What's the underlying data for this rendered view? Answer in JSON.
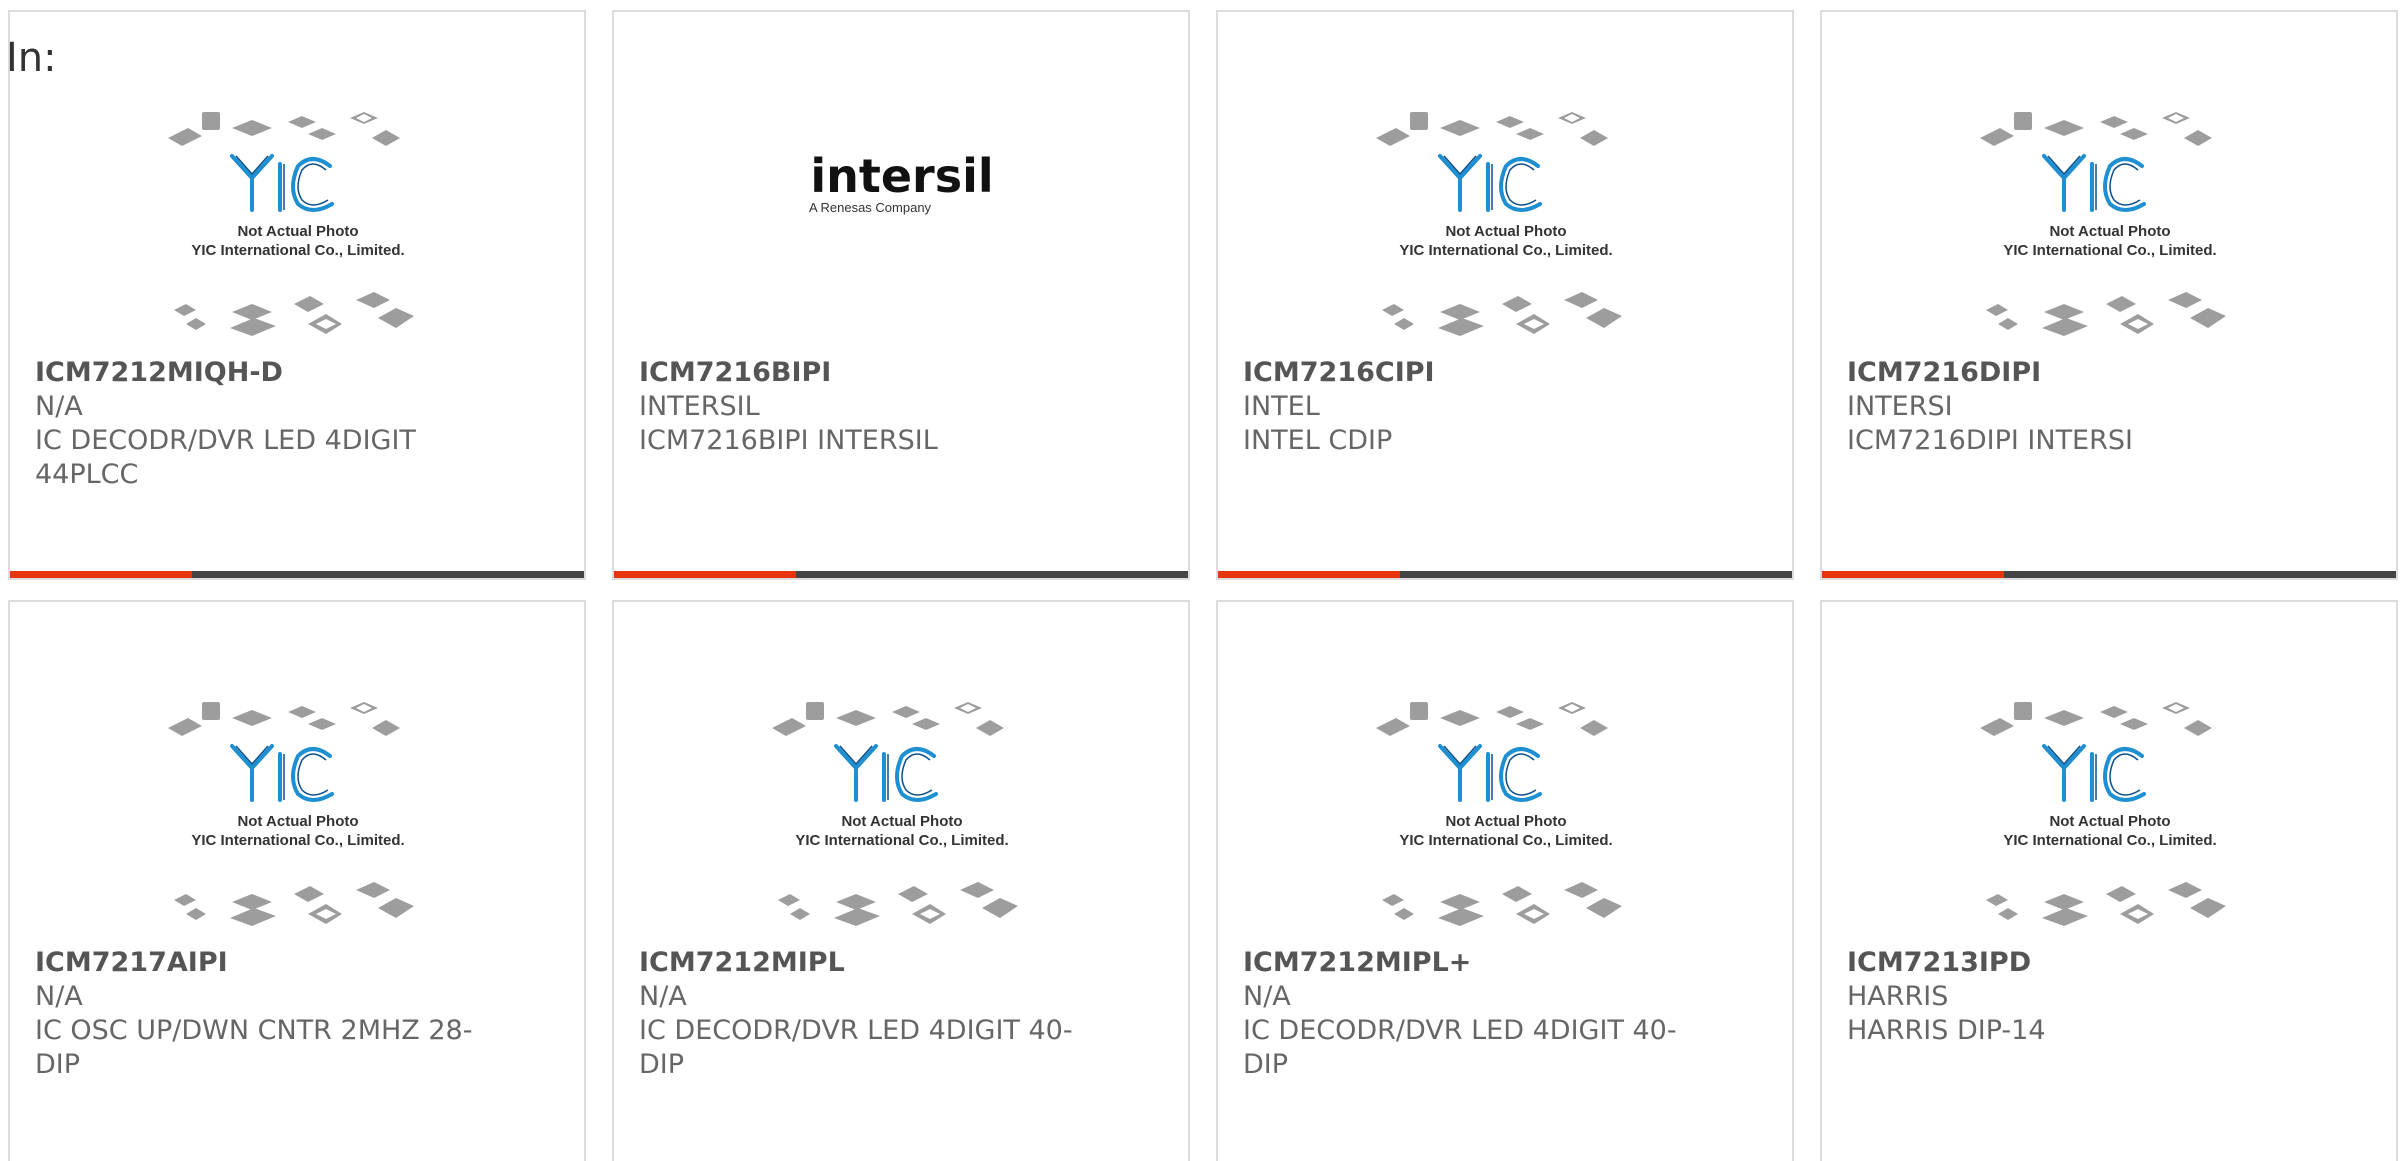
{
  "header": {
    "in_label": "In:"
  },
  "placeholder_image": {
    "caption_line1": "Not Actual Photo",
    "caption_line2": "YIC International Co., Limited.",
    "logo_text": "YIC"
  },
  "intersil_logo": {
    "name": "intersil",
    "tagline": "A Renesas Company"
  },
  "colors": {
    "accent": "#e8340c",
    "bar": "#444444",
    "yic_blue": "#1e8fd0"
  },
  "products": [
    {
      "part": "ICM7212MIQH-D",
      "manufacturer": "N/A",
      "desc_line1": "IC DECODR/DVR LED 4DIGIT",
      "desc_line2": "44PLCC",
      "image": "placeholder"
    },
    {
      "part": "ICM7216BIPI",
      "manufacturer": "INTERSIL",
      "desc_line1": "ICM7216BIPI INTERSIL",
      "desc_line2": "",
      "image": "intersil"
    },
    {
      "part": "ICM7216CIPI",
      "manufacturer": "INTEL",
      "desc_line1": "INTEL CDIP",
      "desc_line2": "",
      "image": "placeholder"
    },
    {
      "part": "ICM7216DIPI",
      "manufacturer": "INTERSI",
      "desc_line1": "ICM7216DIPI INTERSI",
      "desc_line2": "",
      "image": "placeholder"
    },
    {
      "part": "ICM7217AIPI",
      "manufacturer": "N/A",
      "desc_line1": "IC OSC UP/DWN CNTR 2MHZ 28-",
      "desc_line2": "DIP",
      "image": "placeholder"
    },
    {
      "part": "ICM7212MIPL",
      "manufacturer": "N/A",
      "desc_line1": "IC DECODR/DVR LED 4DIGIT 40-",
      "desc_line2": "DIP",
      "image": "placeholder"
    },
    {
      "part": "ICM7212MIPL+",
      "manufacturer": "N/A",
      "desc_line1": "IC DECODR/DVR LED 4DIGIT 40-",
      "desc_line2": "DIP",
      "image": "placeholder"
    },
    {
      "part": "ICM7213IPD",
      "manufacturer": "HARRIS",
      "desc_line1": "HARRIS DIP-14",
      "desc_line2": "",
      "image": "placeholder"
    }
  ]
}
